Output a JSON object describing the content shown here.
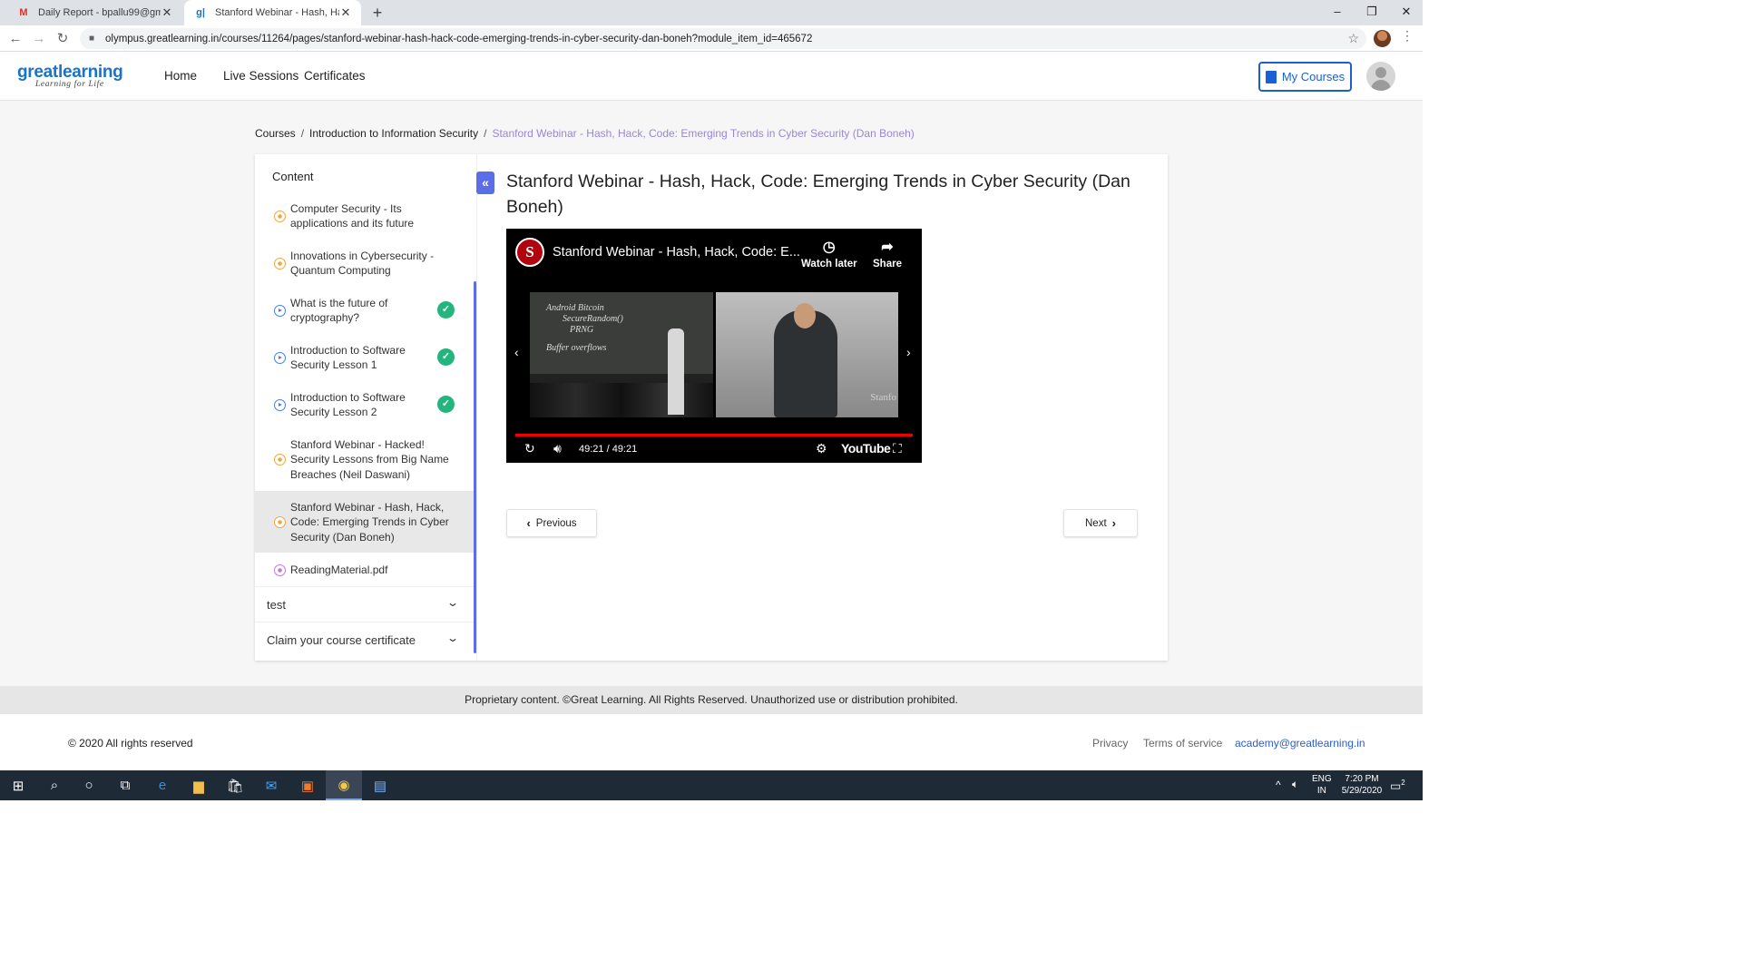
{
  "browser": {
    "tabs": [
      {
        "title": "Daily Report - bpallu99@gmail.c",
        "favicon": "gmail-icon",
        "favicon_char": "M"
      },
      {
        "title": "Stanford Webinar - Hash, Hack, C",
        "favicon": "greatlearning-icon",
        "favicon_char": "g|"
      }
    ],
    "url": "olympus.greatlearning.in/courses/11264/pages/stanford-webinar-hash-hack-code-emerging-trends-in-cyber-security-dan-boneh?module_item_id=465672"
  },
  "site": {
    "logo_main": "greatlearning",
    "logo_tagline": "Learning for Life",
    "nav": [
      "Home",
      "Live Sessions",
      "Certificates"
    ],
    "my_courses": "My Courses"
  },
  "breadcrumb": {
    "items": [
      "Courses",
      "Introduction to Information Security"
    ],
    "current": "Stanford Webinar - Hash, Hack, Code: Emerging Trends in Cyber Security (Dan Boneh)",
    "separator": "/"
  },
  "sidebar": {
    "heading": "Content",
    "collapse_icon": "«",
    "items": [
      {
        "label": "Computer Security - Its applications and its future",
        "icon": "article-icon",
        "completed": false
      },
      {
        "label": "Innovations in Cybersecurity - Quantum Computing",
        "icon": "article-icon",
        "completed": false
      },
      {
        "label": "What is the future of cryptography?",
        "icon": "video-icon",
        "completed": true
      },
      {
        "label": "Introduction to Software Security Lesson 1",
        "icon": "video-icon",
        "completed": true
      },
      {
        "label": "Introduction to Software Security Lesson 2",
        "icon": "video-icon",
        "completed": true
      },
      {
        "label": "Stanford Webinar - Hacked! Security Lessons from Big Name Breaches (Neil Daswani)",
        "icon": "article-icon",
        "completed": false
      },
      {
        "label": "Stanford Webinar - Hash, Hack, Code: Emerging Trends in Cyber Security (Dan Boneh)",
        "icon": "article-icon",
        "completed": false,
        "active": true
      },
      {
        "label": "ReadingMaterial.pdf",
        "icon": "pdf-icon",
        "completed": false
      }
    ],
    "sections": [
      "test",
      "Claim your course certificate"
    ]
  },
  "main": {
    "title": "Stanford Webinar - Hash, Hack, Code: Emerging Trends in Cyber Security (Dan Boneh)",
    "video": {
      "channel_logo": "S",
      "title": "Stanford Webinar - Hash, Hack, Code: E...",
      "watch_later": "Watch later",
      "share": "Share",
      "time": "49:21 / 49:21",
      "brand": "YouTube",
      "board_text": [
        "Android Bitcoin",
        "SecureRandom()",
        "PRNG",
        "Buffer overflows"
      ],
      "watermark": "Stanfo"
    },
    "previous": "Previous",
    "next": "Next"
  },
  "footer": {
    "notice": "Proprietary content. ©Great Learning. All Rights Reserved. Unauthorized use or distribution prohibited.",
    "copyright": "© 2020 All rights reserved",
    "links": [
      "Privacy",
      "Terms of service",
      "academy@greatlearning.in"
    ]
  },
  "taskbar": {
    "lang_top": "ENG",
    "lang_bottom": "IN",
    "time": "7:20 PM",
    "date": "5/29/2020",
    "notifications": "2"
  }
}
